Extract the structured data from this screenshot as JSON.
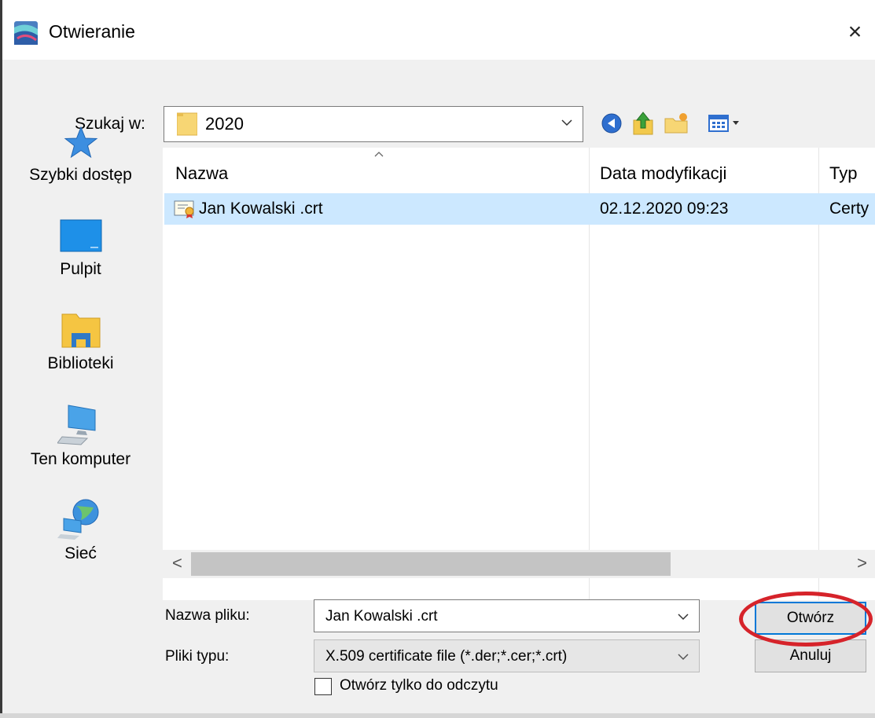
{
  "window": {
    "title": "Otwieranie",
    "close_glyph": "×"
  },
  "look_in": {
    "label": "Szukaj w:",
    "value": "2020"
  },
  "toolbar": {
    "icons": [
      "back-icon",
      "up-folder-icon",
      "new-folder-icon",
      "view-menu-icon"
    ]
  },
  "places": [
    {
      "label": "Szybki dostęp",
      "icon": "star-icon"
    },
    {
      "label": "Pulpit",
      "icon": "desktop-icon"
    },
    {
      "label": "Biblioteki",
      "icon": "libraries-icon"
    },
    {
      "label": "Ten komputer",
      "icon": "computer-icon"
    },
    {
      "label": "Sieć",
      "icon": "network-icon"
    }
  ],
  "file_list": {
    "columns": [
      "Nazwa",
      "Data modyfikacji",
      "Typ"
    ],
    "rows": [
      {
        "name": "Jan Kowalski .crt",
        "modified": "02.12.2020 09:23",
        "type": "Certy"
      }
    ],
    "scroll_left": "<",
    "scroll_right": ">"
  },
  "form": {
    "filename_label": "Nazwa pliku:",
    "filename_value": "Jan Kowalski .crt",
    "filetype_label": "Pliki typu:",
    "filetype_value": "X.509 certificate file (*.der;*.cer;*.crt)",
    "readonly_label": "Otwórz tylko do odczytu"
  },
  "buttons": {
    "open": "Otwórz",
    "cancel": "Anuluj"
  },
  "colors": {
    "selection": "#cce8ff",
    "accent": "#0078d7",
    "annotation": "#d6232a"
  }
}
